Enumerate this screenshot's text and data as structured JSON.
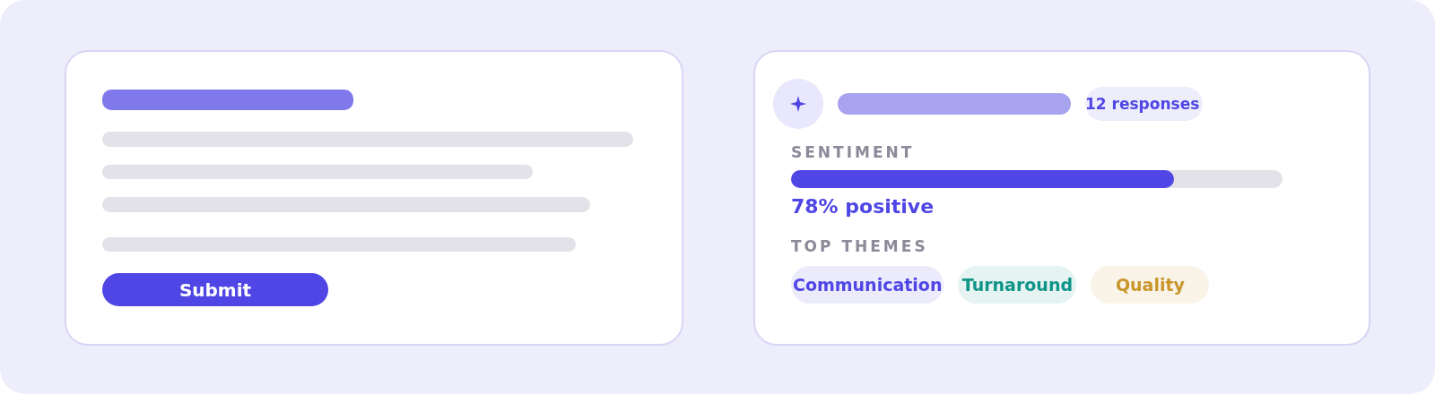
{
  "form_card": {
    "submit_button": "Submit"
  },
  "summary_card": {
    "response_count": "12 responses",
    "sentiment": {
      "label": "SENTIMENT",
      "level": 0.78,
      "reading": "78% positive"
    },
    "themes": {
      "label": "TOP THEMES",
      "tags": [
        {
          "label": "Communication",
          "color": "#4f46e5"
        },
        {
          "label": "Turnaround",
          "color": "#0f9488"
        },
        {
          "label": "Quality",
          "color": "#c9962a"
        }
      ]
    }
  }
}
